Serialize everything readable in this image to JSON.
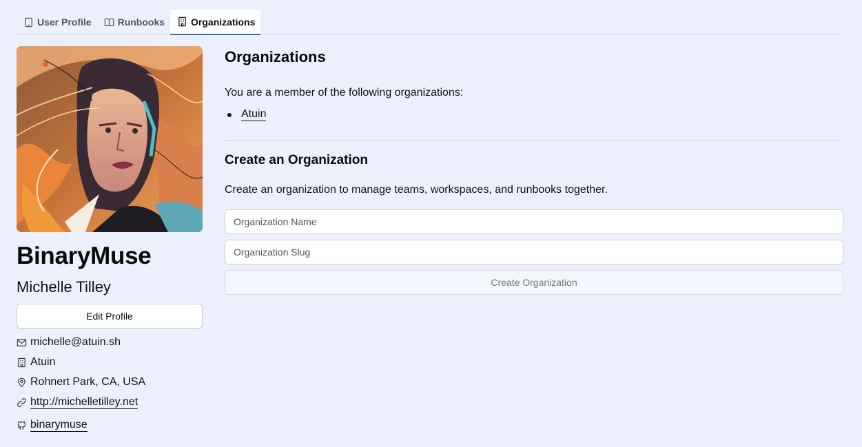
{
  "tabs": [
    {
      "label": "User Profile",
      "icon": "tablet-icon",
      "active": false
    },
    {
      "label": "Runbooks",
      "icon": "book-icon",
      "active": false
    },
    {
      "label": "Organizations",
      "icon": "building-icon",
      "active": true
    }
  ],
  "profile": {
    "avatar_alt": "avatar portrait illustration",
    "username": "BinaryMuse",
    "full_name": "Michelle Tilley",
    "edit_label": "Edit Profile",
    "email": "michelle@atuin.sh",
    "company": "Atuin",
    "location": "Rohnert Park, CA, USA",
    "website": "http://michelletilley.net",
    "github": "binarymuse"
  },
  "organizations": {
    "title": "Organizations",
    "member_text": "You are a member of the following organizations:",
    "list": [
      "Atuin"
    ]
  },
  "create": {
    "title": "Create an Organization",
    "description": "Create an organization to manage teams, workspaces, and runbooks together.",
    "name_placeholder": "Organization Name",
    "slug_placeholder": "Organization Slug",
    "button_label": "Create Organization"
  },
  "colors": {
    "background": "#ebf0fc",
    "active_tab_underline": "#3b6fb8"
  }
}
